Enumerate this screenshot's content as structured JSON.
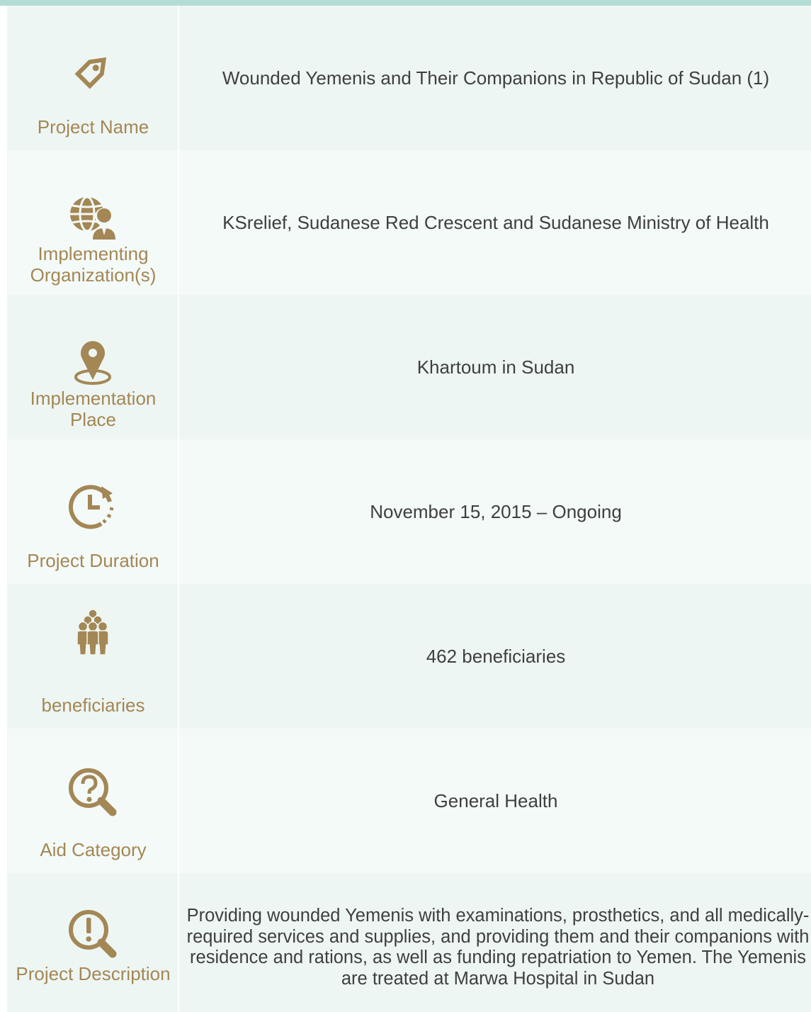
{
  "rows": [
    {
      "label": "Project Name",
      "icon": "tag-icon",
      "value": "Wounded Yemenis and Their Companions in Republic of Sudan (1)"
    },
    {
      "label": "Implementing Organization(s)",
      "icon": "globe-person-icon",
      "value": "KSrelief, Sudanese Red Crescent and Sudanese Ministry of Health"
    },
    {
      "label": "Implementation Place",
      "icon": "location-pin-icon",
      "value": "Khartoum in Sudan"
    },
    {
      "label": "Project Duration",
      "icon": "clock-history-icon",
      "value": "November 15, 2015 – Ongoing"
    },
    {
      "label": "beneficiaries",
      "icon": "people-group-icon",
      "value": "462 beneficiaries"
    },
    {
      "label": "Aid Category",
      "icon": "question-search-icon",
      "value": "General Health"
    },
    {
      "label": "Project Description",
      "icon": "exclamation-search-icon",
      "value": "Providing wounded Yemenis with examinations, prosthetics, and all medically-required services and supplies, and providing them and their companions with residence and rations, as well as funding repatriation to Yemen. The Yemenis are treated at Marwa Hospital in Sudan"
    }
  ],
  "colors": {
    "accent": "#a38755",
    "text": "#3f3f3f",
    "row_odd": "#eef6f3",
    "row_even": "#f4faf8",
    "top_bar": "#b3dcd5"
  }
}
